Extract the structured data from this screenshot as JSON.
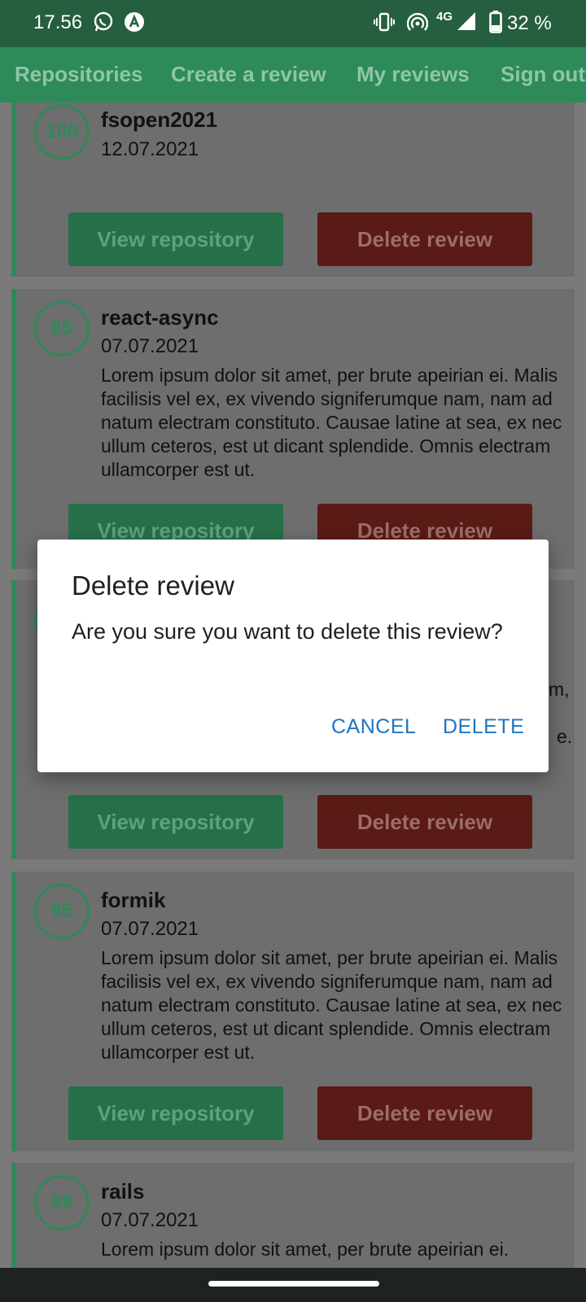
{
  "status_bar": {
    "time": "17.56",
    "network": "4G",
    "battery": "32 %",
    "icons": [
      "whatsapp-icon",
      "app-notification-icon",
      "vibrate-icon",
      "hotspot-icon",
      "signal-icon",
      "battery-icon"
    ]
  },
  "nav": {
    "tabs": [
      "Repositories",
      "Create a review",
      "My reviews",
      "Sign out"
    ]
  },
  "reviews": [
    {
      "score": "100",
      "name": "fsopen2021",
      "date": "12.07.2021",
      "text": "",
      "view_label": "View repository",
      "delete_label": "Delete review"
    },
    {
      "score": "85",
      "name": "react-async",
      "date": "07.07.2021",
      "text": "Lorem ipsum dolor sit amet, per brute apeirian ei. Malis facilisis vel ex, ex vivendo signiferumque nam, nam ad natum electram constituto. Causae latine at sea, ex nec ullum ceteros, est ut dicant splendide. Omnis electram ullamcorper est ut.",
      "view_label": "View repository",
      "delete_label": "Delete review"
    },
    {
      "view_label": "View repository",
      "delete_label": "Delete review",
      "partial_text_1": "m,",
      "partial_text_2": "e."
    },
    {
      "score": "95",
      "name": "formik",
      "date": "07.07.2021",
      "text": "Lorem ipsum dolor sit amet, per brute apeirian ei. Malis facilisis vel ex, ex vivendo signiferumque nam, nam ad natum electram constituto. Causae latine at sea, ex nec ullum ceteros, est ut dicant splendide. Omnis electram ullamcorper est ut.",
      "view_label": "View repository",
      "delete_label": "Delete review"
    },
    {
      "score": "99",
      "name": "rails",
      "date": "07.07.2021",
      "text": "Lorem ipsum dolor sit amet, per brute apeirian ei."
    }
  ],
  "dialog": {
    "title": "Delete review",
    "message": "Are you sure you want to delete this review?",
    "cancel_label": "CANCEL",
    "delete_label": "DELETE"
  },
  "colors": {
    "status_bar": "#255f40",
    "app_bar": "#2e8a59",
    "primary": "#2e8a59",
    "danger": "#5a1a15",
    "dialog_action": "#1e74c3",
    "scrim_card": "#6e6e6e"
  }
}
